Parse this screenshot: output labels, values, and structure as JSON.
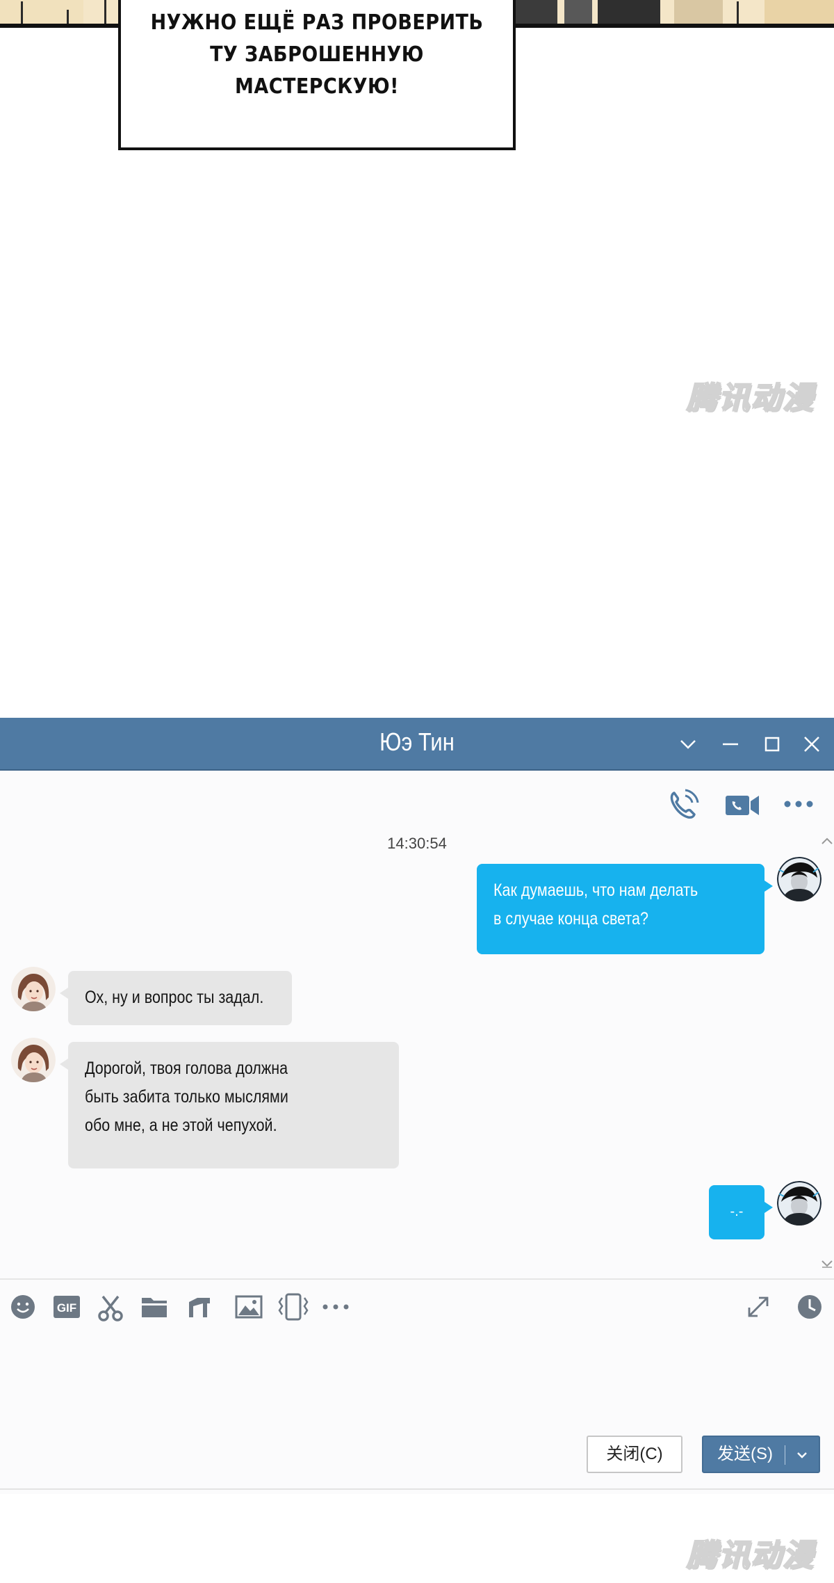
{
  "comic": {
    "caption_line1": "НУЖНО ЕЩЁ РАЗ ПРОВЕРИТЬ",
    "caption_line2": "ТУ ЗАБРОШЕННУЮ МАСТЕРСКУЮ!",
    "watermark": "腾讯动漫"
  },
  "window": {
    "title": "Юэ Тин",
    "controls": [
      "chevron-down-icon",
      "minimize-icon",
      "maximize-icon",
      "close-icon"
    ],
    "accent_color": "#4f7aa3"
  },
  "chat_actions": [
    "phone-icon",
    "video-call-icon",
    "more-icon"
  ],
  "timestamp": "14:30:54",
  "messages": [
    {
      "direction": "out",
      "lines": [
        "Как думаешь, что нам делать",
        "в случае конца света?"
      ]
    },
    {
      "direction": "in",
      "lines": [
        "Ох, ну и вопрос ты задал."
      ]
    },
    {
      "direction": "in",
      "lines": [
        "Дорогой, твоя голова должна",
        "быть забита только мыслями",
        "обо мне, а не этой чепухой."
      ]
    },
    {
      "direction": "out",
      "lines": [
        "-.-"
      ]
    }
  ],
  "bubble_colors": {
    "out": "#17b2ee",
    "in": "#e6e6e6"
  },
  "input_toolbar": [
    "emoji-icon",
    "gif-icon",
    "scissors-icon",
    "folder-icon",
    "music-icon",
    "image-icon",
    "shake-icon",
    "more-icon",
    "expand-icon",
    "history-icon"
  ],
  "input_toolbar_gif_label": "GIF",
  "buttons": {
    "close_label": "关闭(C)",
    "send_label": "发送(S)"
  }
}
